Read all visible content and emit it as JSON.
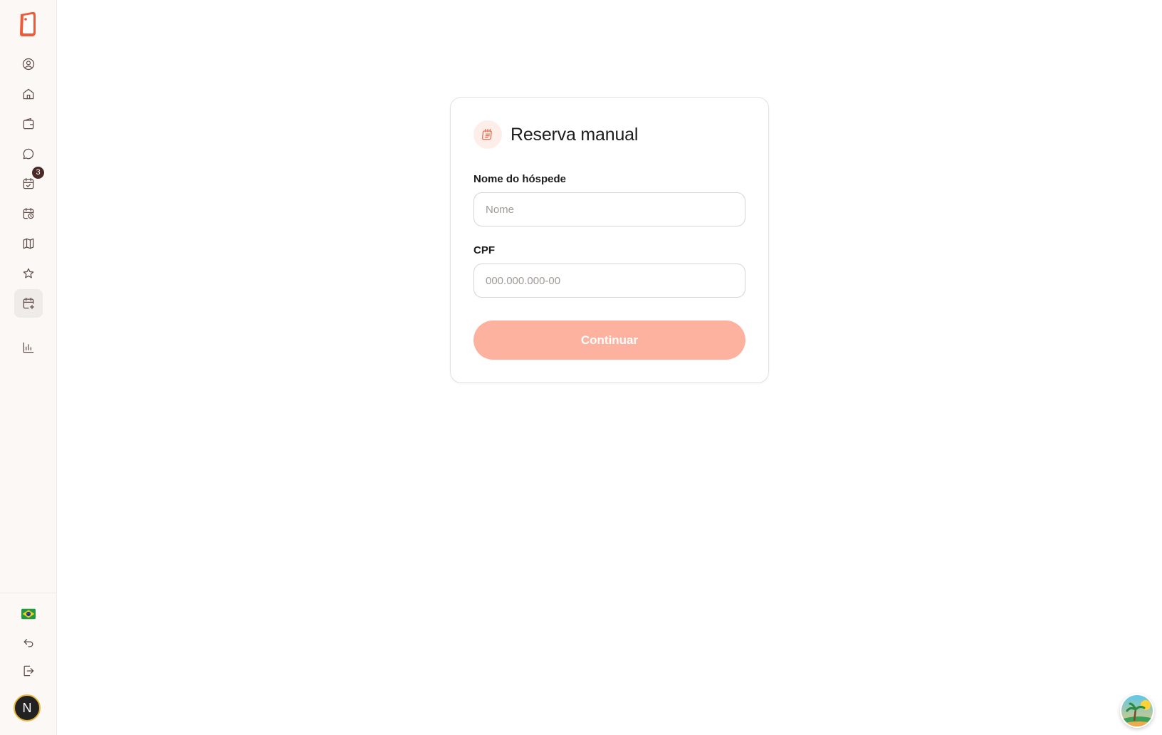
{
  "sidebar": {
    "nav_items": [
      {
        "name": "profile",
        "icon": "user-circle-icon"
      },
      {
        "name": "home",
        "icon": "home-icon"
      },
      {
        "name": "wallet",
        "icon": "wallet-icon"
      },
      {
        "name": "messages",
        "icon": "chat-bubble-icon"
      },
      {
        "name": "tasks",
        "icon": "calendar-check-icon",
        "badge": "3"
      },
      {
        "name": "schedule",
        "icon": "calendar-clock-icon"
      },
      {
        "name": "map",
        "icon": "map-icon"
      },
      {
        "name": "favorites",
        "icon": "star-icon"
      },
      {
        "name": "manual-booking",
        "icon": "calendar-plus-icon",
        "active": true
      },
      {
        "name": "reports",
        "icon": "bar-chart-icon"
      }
    ],
    "bottom_items": [
      {
        "name": "language",
        "icon": "brazil-flag-icon"
      },
      {
        "name": "back",
        "icon": "undo-arrow-icon"
      },
      {
        "name": "logout",
        "icon": "logout-icon"
      }
    ],
    "avatar_initial": "N",
    "tasks_badge": "3"
  },
  "form": {
    "title": "Reserva manual",
    "guest_name_label": "Nome do hóspede",
    "guest_name_placeholder": "Nome",
    "guest_name_value": "",
    "cpf_label": "CPF",
    "cpf_placeholder": "000.000.000-00",
    "cpf_value": "",
    "continue_label": "Continuar"
  },
  "colors": {
    "brand": "#ee6a4a",
    "button_disabled": "#fdb2a0",
    "sidebar_bg": "#fbf8f5",
    "badge": "#4a2a27"
  }
}
